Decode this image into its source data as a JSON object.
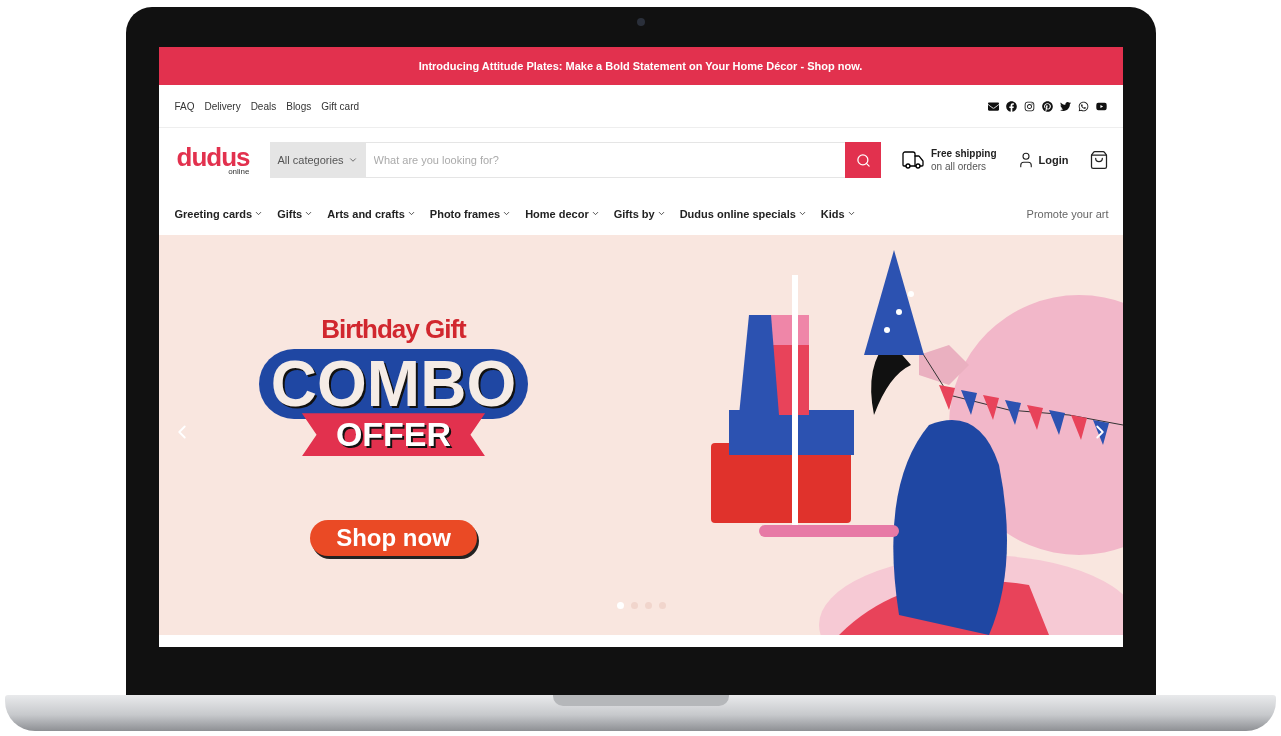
{
  "announcement": "Introducing Attitude Plates: Make a Bold Statement on Your Home Décor - Shop now.",
  "top_links": [
    "FAQ",
    "Delivery",
    "Deals",
    "Blogs",
    "Gift card"
  ],
  "logo": {
    "name": "dudus",
    "tagline": "online"
  },
  "search": {
    "category": "All categories",
    "placeholder": "What are you looking for?"
  },
  "shipping": {
    "title": "Free shipping",
    "subtitle": "on all orders"
  },
  "login": "Login",
  "nav": [
    "Greeting cards",
    "Gifts",
    "Arts and crafts",
    "Photo frames",
    "Home decor",
    "Gifts by",
    "Dudus online specials",
    "Kids"
  ],
  "promote": "Promote your art",
  "hero": {
    "kicker": "Birthday Gift",
    "headline": "COMBO",
    "ribbon": "OFFER",
    "button": "Shop now",
    "slides": [
      {
        "selected": true
      },
      {
        "selected": false
      },
      {
        "selected": false
      },
      {
        "selected": false
      }
    ]
  }
}
